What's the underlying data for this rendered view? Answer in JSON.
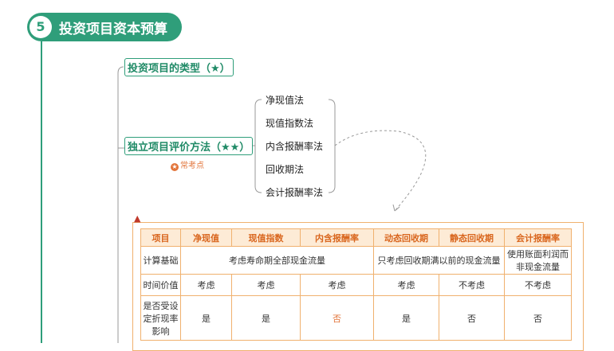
{
  "chapter": {
    "number": "5",
    "title": "投资项目资本预算"
  },
  "branch_types": {
    "label": "投资项目的类型（★）"
  },
  "branch_methods": {
    "label": "独立项目评价方法（★★）",
    "tag": "常考点"
  },
  "methods": [
    "净现值法",
    "现值指数法",
    "内含报酬率法",
    "回收期法",
    "会计报酬率法"
  ],
  "table": {
    "headers": [
      "项目",
      "净现值",
      "现值指数",
      "内含报酬率",
      "动态回收期",
      "静态回收期",
      "会计报酬率"
    ],
    "row_basis": {
      "label": "计算基础",
      "npv_group": "考虑寿命期全部现金流量",
      "payback_group": "只考虑回收期满以前的现金流量",
      "arr": "使用账面利润而非现金流量"
    },
    "row_time": {
      "label": "时间价值",
      "values": [
        "考虑",
        "考虑",
        "考虑",
        "考虑",
        "不考虑",
        "不考虑"
      ]
    },
    "row_rate": {
      "label": "是否受设定折现率影响",
      "values": [
        "是",
        "是",
        "否",
        "是",
        "否",
        "否"
      ]
    }
  },
  "colors": {
    "primary": "#2f9e7a",
    "accent": "#e2743a",
    "table_border": "#f0b16e",
    "header_bg": "#fdebd6"
  }
}
